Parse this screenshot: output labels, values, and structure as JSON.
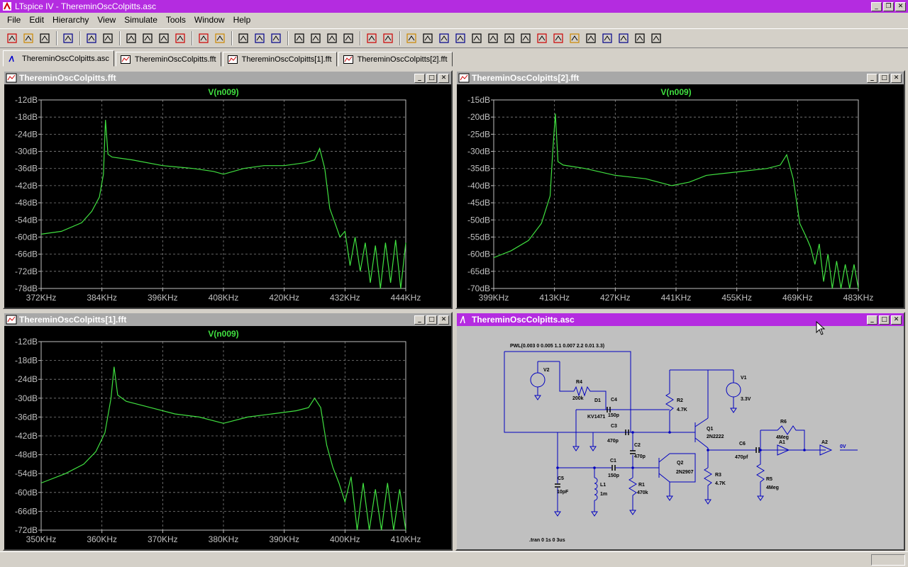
{
  "app": {
    "title": "LTspice IV - ThereminOscColpitts.asc",
    "window_buttons": [
      "_",
      "❐",
      "✕"
    ]
  },
  "menu": [
    "File",
    "Edit",
    "Hierarchy",
    "View",
    "Simulate",
    "Tools",
    "Window",
    "Help"
  ],
  "toolbar_icons": [
    "new-schematic-icon",
    "open-icon",
    "save-icon",
    "control-panel-icon",
    "run-icon",
    "halt-icon",
    "zoom-in-icon",
    "zoom-pan-icon",
    "zoom-out-icon",
    "zoom-cancel-icon",
    "autorange-icon",
    "grid-icon",
    "tile-horizontal-icon",
    "cascade-icon",
    "tile-vertical-icon",
    "cut-icon",
    "copy-icon",
    "paste-icon",
    "find-icon",
    "print-setup-icon",
    "print-icon",
    "wire-icon",
    "ground-icon",
    "label-icon",
    "resistor-icon",
    "capacitor-icon",
    "inductor-icon",
    "diode-icon",
    "component-icon",
    "move-icon",
    "drag-icon",
    "undo-icon",
    "redo-icon",
    "rotate-icon",
    "mirror-icon",
    "text-icon",
    "spice-directive-icon"
  ],
  "tabs": [
    {
      "label": "ThereminOscColpitts.asc",
      "icon": "schematic-icon",
      "active": true
    },
    {
      "label": "ThereminOscColpitts.fft",
      "icon": "waveform-icon",
      "active": false
    },
    {
      "label": "ThereminOscColpitts[1].fft",
      "icon": "waveform-icon",
      "active": false
    },
    {
      "label": "ThereminOscColpitts[2].fft",
      "icon": "waveform-icon",
      "active": false
    }
  ],
  "windows": {
    "fft0": {
      "title": "ThereminOscColpitts.fft"
    },
    "fft2": {
      "title": "ThereminOscColpitts[2].fft"
    },
    "fft1": {
      "title": "ThereminOscColpitts[1].fft"
    },
    "schem": {
      "title": "ThereminOscColpitts.asc"
    }
  },
  "chart_data": [
    {
      "type": "line",
      "window": "fft0",
      "title": "V(n009)",
      "x_ticks": [
        "372KHz",
        "384KHz",
        "396KHz",
        "408KHz",
        "420KHz",
        "432KHz",
        "444KHz"
      ],
      "y_ticks": [
        "-12dB",
        "-18dB",
        "-24dB",
        "-30dB",
        "-36dB",
        "-42dB",
        "-48dB",
        "-54dB",
        "-60dB",
        "-66dB",
        "-72dB",
        "-78dB"
      ],
      "xlim": [
        372,
        444
      ],
      "ylim": [
        -78,
        -12
      ],
      "x_unit": "KHz",
      "y_unit": "dB",
      "grid": true,
      "series": [
        {
          "color": "#40e040",
          "points": [
            [
              372,
              -59
            ],
            [
              376,
              -58
            ],
            [
              380,
              -55
            ],
            [
              382,
              -51
            ],
            [
              383.5,
              -46
            ],
            [
              384.3,
              -38
            ],
            [
              384.7,
              -19
            ],
            [
              385.2,
              -31
            ],
            [
              386,
              -32
            ],
            [
              390,
              -33
            ],
            [
              396,
              -35
            ],
            [
              402,
              -36
            ],
            [
              406,
              -37
            ],
            [
              408,
              -38
            ],
            [
              412,
              -36
            ],
            [
              416,
              -35
            ],
            [
              420,
              -35
            ],
            [
              424,
              -34
            ],
            [
              426,
              -33
            ],
            [
              427,
              -29
            ],
            [
              428,
              -36
            ],
            [
              429,
              -50
            ],
            [
              430,
              -55
            ],
            [
              431,
              -60
            ],
            [
              432,
              -58
            ],
            [
              433,
              -70
            ],
            [
              434,
              -60
            ],
            [
              435,
              -72
            ],
            [
              436,
              -62
            ],
            [
              437,
              -76
            ],
            [
              438,
              -63
            ],
            [
              439,
              -78
            ],
            [
              440,
              -62
            ],
            [
              441,
              -76
            ],
            [
              442,
              -61
            ],
            [
              443,
              -78
            ],
            [
              444,
              -62
            ]
          ]
        }
      ]
    },
    {
      "type": "line",
      "window": "fft2",
      "title": "V(n009)",
      "x_ticks": [
        "399KHz",
        "413KHz",
        "427KHz",
        "441KHz",
        "455KHz",
        "469KHz",
        "483KHz"
      ],
      "y_ticks": [
        "-15dB",
        "-20dB",
        "-25dB",
        "-30dB",
        "-35dB",
        "-40dB",
        "-45dB",
        "-50dB",
        "-55dB",
        "-60dB",
        "-65dB",
        "-70dB"
      ],
      "xlim": [
        399,
        483
      ],
      "ylim": [
        -70,
        -15
      ],
      "x_unit": "KHz",
      "y_unit": "dB",
      "grid": true,
      "series": [
        {
          "color": "#40e040",
          "points": [
            [
              399,
              -61
            ],
            [
              403,
              -59
            ],
            [
              407,
              -56
            ],
            [
              410,
              -51
            ],
            [
              412,
              -43
            ],
            [
              412.6,
              -30
            ],
            [
              413.2,
              -19
            ],
            [
              413.8,
              -33
            ],
            [
              415,
              -34
            ],
            [
              420,
              -35
            ],
            [
              427,
              -37
            ],
            [
              434,
              -38
            ],
            [
              440,
              -40
            ],
            [
              444,
              -39
            ],
            [
              448,
              -37
            ],
            [
              455,
              -36
            ],
            [
              462,
              -35
            ],
            [
              465,
              -34
            ],
            [
              466.5,
              -31
            ],
            [
              468,
              -38
            ],
            [
              469.5,
              -51
            ],
            [
              471,
              -55
            ],
            [
              472,
              -58
            ],
            [
              473,
              -63
            ],
            [
              474,
              -57
            ],
            [
              475,
              -68
            ],
            [
              476,
              -60
            ],
            [
              477,
              -70
            ],
            [
              478,
              -62
            ],
            [
              479,
              -70
            ],
            [
              480,
              -63
            ],
            [
              481,
              -70
            ],
            [
              482,
              -63
            ],
            [
              483,
              -70
            ]
          ]
        }
      ]
    },
    {
      "type": "line",
      "window": "fft1",
      "title": "V(n009)",
      "x_ticks": [
        "350KHz",
        "360KHz",
        "370KHz",
        "380KHz",
        "390KHz",
        "400KHz",
        "410KHz"
      ],
      "y_ticks": [
        "-12dB",
        "-18dB",
        "-24dB",
        "-30dB",
        "-36dB",
        "-42dB",
        "-48dB",
        "-54dB",
        "-60dB",
        "-66dB",
        "-72dB"
      ],
      "xlim": [
        350,
        410
      ],
      "ylim": [
        -72,
        -12
      ],
      "x_unit": "KHz",
      "y_unit": "dB",
      "grid": true,
      "series": [
        {
          "color": "#40e040",
          "points": [
            [
              350,
              -57
            ],
            [
              354,
              -54
            ],
            [
              357,
              -51
            ],
            [
              359,
              -47
            ],
            [
              360.5,
              -41
            ],
            [
              361.5,
              -30
            ],
            [
              362,
              -20
            ],
            [
              362.6,
              -29
            ],
            [
              364,
              -31
            ],
            [
              368,
              -33
            ],
            [
              372,
              -35
            ],
            [
              376,
              -36
            ],
            [
              380,
              -38
            ],
            [
              384,
              -36
            ],
            [
              388,
              -35
            ],
            [
              392,
              -34
            ],
            [
              394,
              -33
            ],
            [
              395,
              -30
            ],
            [
              396,
              -33
            ],
            [
              397,
              -45
            ],
            [
              398,
              -52
            ],
            [
              399,
              -57
            ],
            [
              400,
              -63
            ],
            [
              401,
              -55
            ],
            [
              402,
              -72
            ],
            [
              403,
              -57
            ],
            [
              404,
              -72
            ],
            [
              405,
              -59
            ],
            [
              406,
              -72
            ],
            [
              407,
              -57
            ],
            [
              408,
              -72
            ],
            [
              409,
              -59
            ],
            [
              410,
              -72
            ]
          ]
        }
      ]
    }
  ],
  "schematic": {
    "pwl_directive": "PWL(0.003 0 0.005 1.1 0.007 2.2 0.01 3.3)",
    "tran_directive": ".tran 0 1s 0 3us",
    "components": [
      {
        "ref": "V2",
        "value": ""
      },
      {
        "ref": "R4",
        "value": "200k"
      },
      {
        "ref": "D1",
        "value": "KV1471"
      },
      {
        "ref": "C4",
        "value": "150p"
      },
      {
        "ref": "R2",
        "value": "4.7K"
      },
      {
        "ref": "V1",
        "value": "3.3V"
      },
      {
        "ref": "Q1",
        "value": "2N2222"
      },
      {
        "ref": "C3",
        "value": "470p"
      },
      {
        "ref": "C2",
        "value": "470p"
      },
      {
        "ref": "Q2",
        "value": "2N2907"
      },
      {
        "ref": "R3",
        "value": "4.7K"
      },
      {
        "ref": "C6",
        "value": "470pf"
      },
      {
        "ref": "R6",
        "value": "4Meg"
      },
      {
        "ref": "A1",
        "value": ""
      },
      {
        "ref": "A2",
        "value": ""
      },
      {
        "ref": "R5",
        "value": "4Meg"
      },
      {
        "ref": "C1",
        "value": "150p"
      },
      {
        "ref": "R1",
        "value": "470k"
      },
      {
        "ref": "C5",
        "value": "10pF"
      },
      {
        "ref": "L1",
        "value": "1m"
      }
    ],
    "net_label": "0V"
  },
  "colors": {
    "title_active": "#b42ce0",
    "title_inactive": "#a8a8a8",
    "trace": "#40e040",
    "wire": "#0000c0",
    "axis_text": "#c0c0c0",
    "plot_title": "#40e040"
  }
}
